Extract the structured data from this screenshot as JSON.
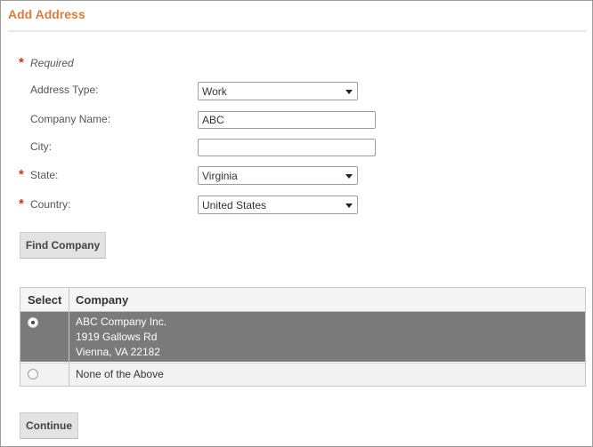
{
  "header": {
    "title": "Add Address"
  },
  "form": {
    "required_note": "Required",
    "address_type": {
      "label": "Address Type:",
      "value": "Work"
    },
    "company_name": {
      "label": "Company Name:",
      "value": "ABC"
    },
    "city": {
      "label": "City:",
      "value": ""
    },
    "state": {
      "label": "State:",
      "value": "Virginia"
    },
    "country": {
      "label": "Country:",
      "value": "United States"
    }
  },
  "buttons": {
    "find_company": "Find Company",
    "continue": "Continue"
  },
  "table": {
    "headers": [
      "Select",
      "Company"
    ],
    "rows": [
      {
        "lines": [
          "ABC Company Inc.",
          "1919 Gallows Rd",
          "Vienna, VA 22182"
        ],
        "selected": true
      },
      {
        "lines": [
          "None of the Above"
        ],
        "selected": false
      }
    ]
  },
  "colors": {
    "accent": "#e07b39",
    "required": "#c0392b",
    "selected_row": "#7a7a7a"
  }
}
